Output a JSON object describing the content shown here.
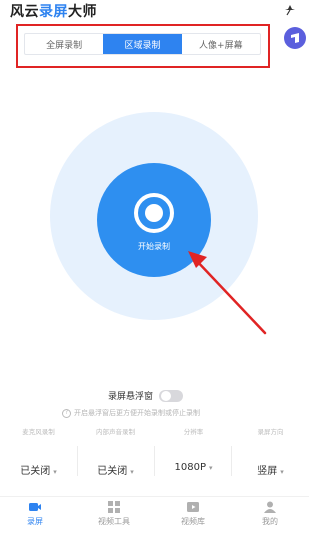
{
  "app": {
    "title_part1": "风云",
    "title_part2": "录屏",
    "title_part3": "大师",
    "accent_color": "#2e83f0"
  },
  "header_icons": [
    "pin-icon",
    "app-badge-icon"
  ],
  "tabs": [
    {
      "label": "全屏录制",
      "active": false
    },
    {
      "label": "区域录制",
      "active": true
    },
    {
      "label": "人像+屏幕",
      "active": false
    }
  ],
  "record": {
    "label": "开始录制",
    "icon": "record-icon"
  },
  "floating_window": {
    "label": "录屏悬浮窗",
    "enabled": false
  },
  "hint": {
    "icon": "question-icon",
    "text": "开启悬浮窗后更方便开始录制或停止录制"
  },
  "settings": [
    {
      "label": "麦克风录制",
      "value": "已关闭"
    },
    {
      "label": "内部声音录制",
      "value": "已关闭"
    },
    {
      "label": "分辨率",
      "value": "1080P"
    },
    {
      "label": "录屏方向",
      "value": "竖屏"
    }
  ],
  "bottom_nav": [
    {
      "label": "录屏",
      "icon": "record-video-icon",
      "active": true
    },
    {
      "label": "视频工具",
      "icon": "tools-grid-icon",
      "active": false
    },
    {
      "label": "视频库",
      "icon": "video-library-icon",
      "active": false
    },
    {
      "label": "我的",
      "icon": "profile-icon",
      "active": false
    }
  ]
}
